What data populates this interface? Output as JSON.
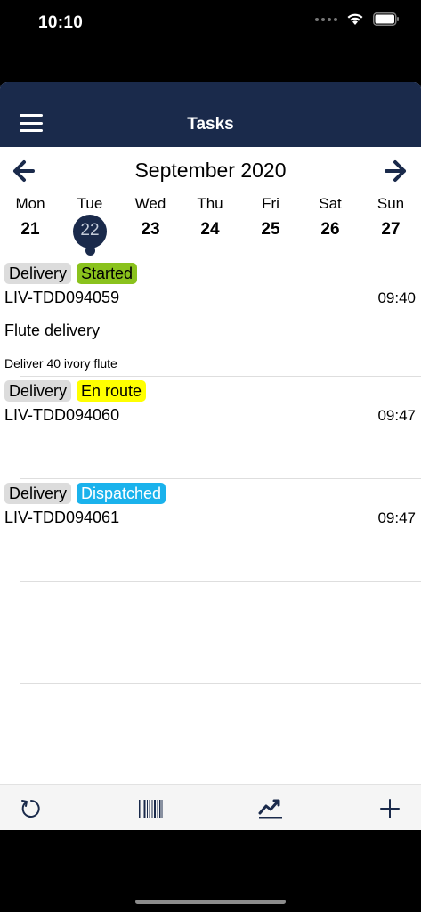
{
  "status_bar": {
    "time": "10:10"
  },
  "header": {
    "title": "Tasks"
  },
  "calendar": {
    "month": "September 2020",
    "days": [
      {
        "name": "Mon",
        "num": "21",
        "selected": false
      },
      {
        "name": "Tue",
        "num": "22",
        "selected": true
      },
      {
        "name": "Wed",
        "num": "23",
        "selected": false
      },
      {
        "name": "Thu",
        "num": "24",
        "selected": false
      },
      {
        "name": "Fri",
        "num": "25",
        "selected": false
      },
      {
        "name": "Sat",
        "num": "26",
        "selected": false
      },
      {
        "name": "Sun",
        "num": "27",
        "selected": false
      }
    ]
  },
  "tasks": [
    {
      "type": "Delivery",
      "status": "Started",
      "status_color": "#8ac21d",
      "id": "LIV-TDD094059",
      "time": "09:40",
      "name": "Flute delivery",
      "description": "Deliver 40 ivory flute"
    },
    {
      "type": "Delivery",
      "status": "En route",
      "status_color": "#ffff00",
      "id": "LIV-TDD094060",
      "time": "09:47",
      "name": "",
      "description": ""
    },
    {
      "type": "Delivery",
      "status": "Dispatched",
      "status_color": "#1ab2ec",
      "id": "LIV-TDD094061",
      "time": "09:47",
      "name": "",
      "description": ""
    }
  ],
  "tab_bar": {
    "items": [
      {
        "icon": "refresh-icon"
      },
      {
        "icon": "barcode-icon"
      },
      {
        "icon": "chart-icon"
      },
      {
        "icon": "plus-icon"
      }
    ]
  },
  "colors": {
    "nav_bg": "#1a2a4b",
    "white_on_dispatched": "#ffffff"
  }
}
